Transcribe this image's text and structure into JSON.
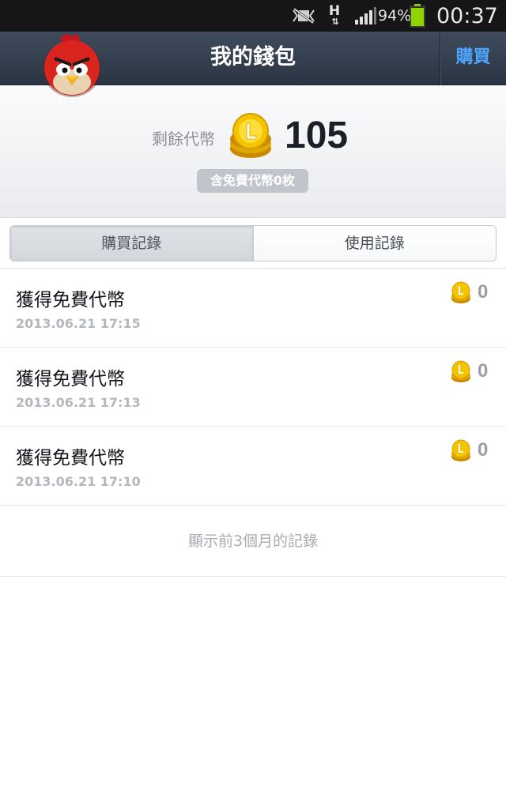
{
  "status_bar": {
    "network_type": "H",
    "network_arrows": "⇅",
    "battery_percent": "94%",
    "battery_level": 0.94,
    "time": "00:37",
    "icons": [
      "silent-mode-icon",
      "signal-icon",
      "battery-icon"
    ]
  },
  "header": {
    "title": "我的錢包",
    "buy_label": "購買",
    "avatar_icon": "angry-bird-avatar",
    "colors": {
      "bar": "#2f3847",
      "buy": "#4da6ff"
    }
  },
  "summary": {
    "remaining_label": "剩餘代幣",
    "coin_icon": "line-coin-icon",
    "coin_count": "105",
    "free_note": "含免費代幣0枚"
  },
  "tabs": [
    {
      "label": "購買記錄",
      "active": true
    },
    {
      "label": "使用記錄",
      "active": false
    }
  ],
  "records": [
    {
      "title": "獲得免費代幣",
      "time": "2013.06.21 17:15",
      "amount": "0"
    },
    {
      "title": "獲得免費代幣",
      "time": "2013.06.21 17:13",
      "amount": "0"
    },
    {
      "title": "獲得免費代幣",
      "time": "2013.06.21 17:10",
      "amount": "0"
    }
  ],
  "footer_note": "顯示前3個月的記錄"
}
